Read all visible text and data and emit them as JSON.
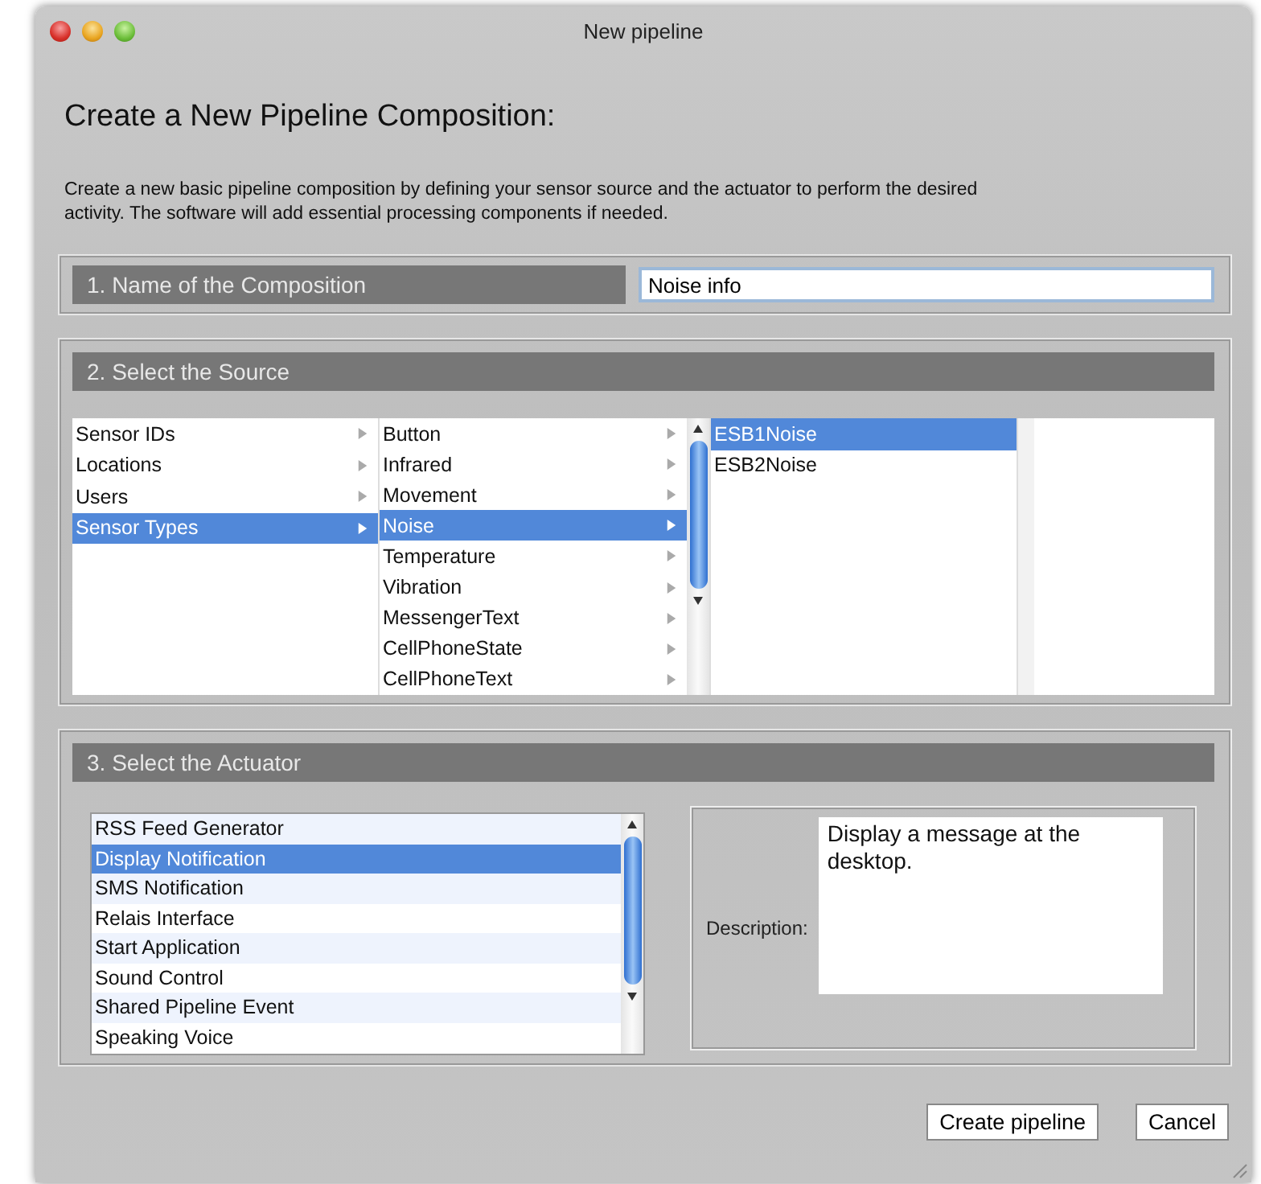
{
  "window": {
    "title": "New pipeline"
  },
  "heading": "Create a New Pipeline Composition:",
  "intro": "Create a new basic pipeline composition by defining your sensor source and the actuator to perform the desired activity. The software will add essential processing components if needed.",
  "name_section": {
    "label": "1. Name of the Composition",
    "value": "Noise info"
  },
  "source_section": {
    "label": "2. Select the Source",
    "columns": [
      {
        "scrollbar": false,
        "items": [
          {
            "label": "Sensor IDs",
            "has_children": true,
            "selected": false
          },
          {
            "label": "Locations",
            "has_children": true,
            "selected": false
          },
          {
            "label": "Users",
            "has_children": true,
            "selected": false
          },
          {
            "label": "Sensor Types",
            "has_children": true,
            "selected": true
          }
        ]
      },
      {
        "scrollbar": true,
        "items": [
          {
            "label": "Button",
            "has_children": true,
            "selected": false
          },
          {
            "label": "Infrared",
            "has_children": true,
            "selected": false
          },
          {
            "label": "Movement",
            "has_children": true,
            "selected": false
          },
          {
            "label": "Noise",
            "has_children": true,
            "selected": true
          },
          {
            "label": "Temperature",
            "has_children": true,
            "selected": false
          },
          {
            "label": "Vibration",
            "has_children": true,
            "selected": false
          },
          {
            "label": "MessengerText",
            "has_children": true,
            "selected": false
          },
          {
            "label": "CellPhoneState",
            "has_children": true,
            "selected": false
          },
          {
            "label": "CellPhoneText",
            "has_children": true,
            "selected": false
          }
        ]
      },
      {
        "scrollbar": false,
        "items": [
          {
            "label": "ESB1Noise",
            "has_children": false,
            "selected": true
          },
          {
            "label": "ESB2Noise",
            "has_children": false,
            "selected": false
          }
        ]
      }
    ]
  },
  "actuator_section": {
    "label": "3. Select the Actuator",
    "items": [
      {
        "label": "RSS Feed Generator",
        "selected": false
      },
      {
        "label": "Display Notification",
        "selected": true
      },
      {
        "label": "SMS Notification",
        "selected": false
      },
      {
        "label": "Relais Interface",
        "selected": false
      },
      {
        "label": "Start Application",
        "selected": false
      },
      {
        "label": "Sound Control",
        "selected": false
      },
      {
        "label": "Shared Pipeline Event",
        "selected": false
      },
      {
        "label": "Speaking Voice",
        "selected": false
      }
    ],
    "description_label": "Description:",
    "description": "Display a message at the desktop."
  },
  "buttons": [
    "Create pipeline",
    "Cancel"
  ]
}
